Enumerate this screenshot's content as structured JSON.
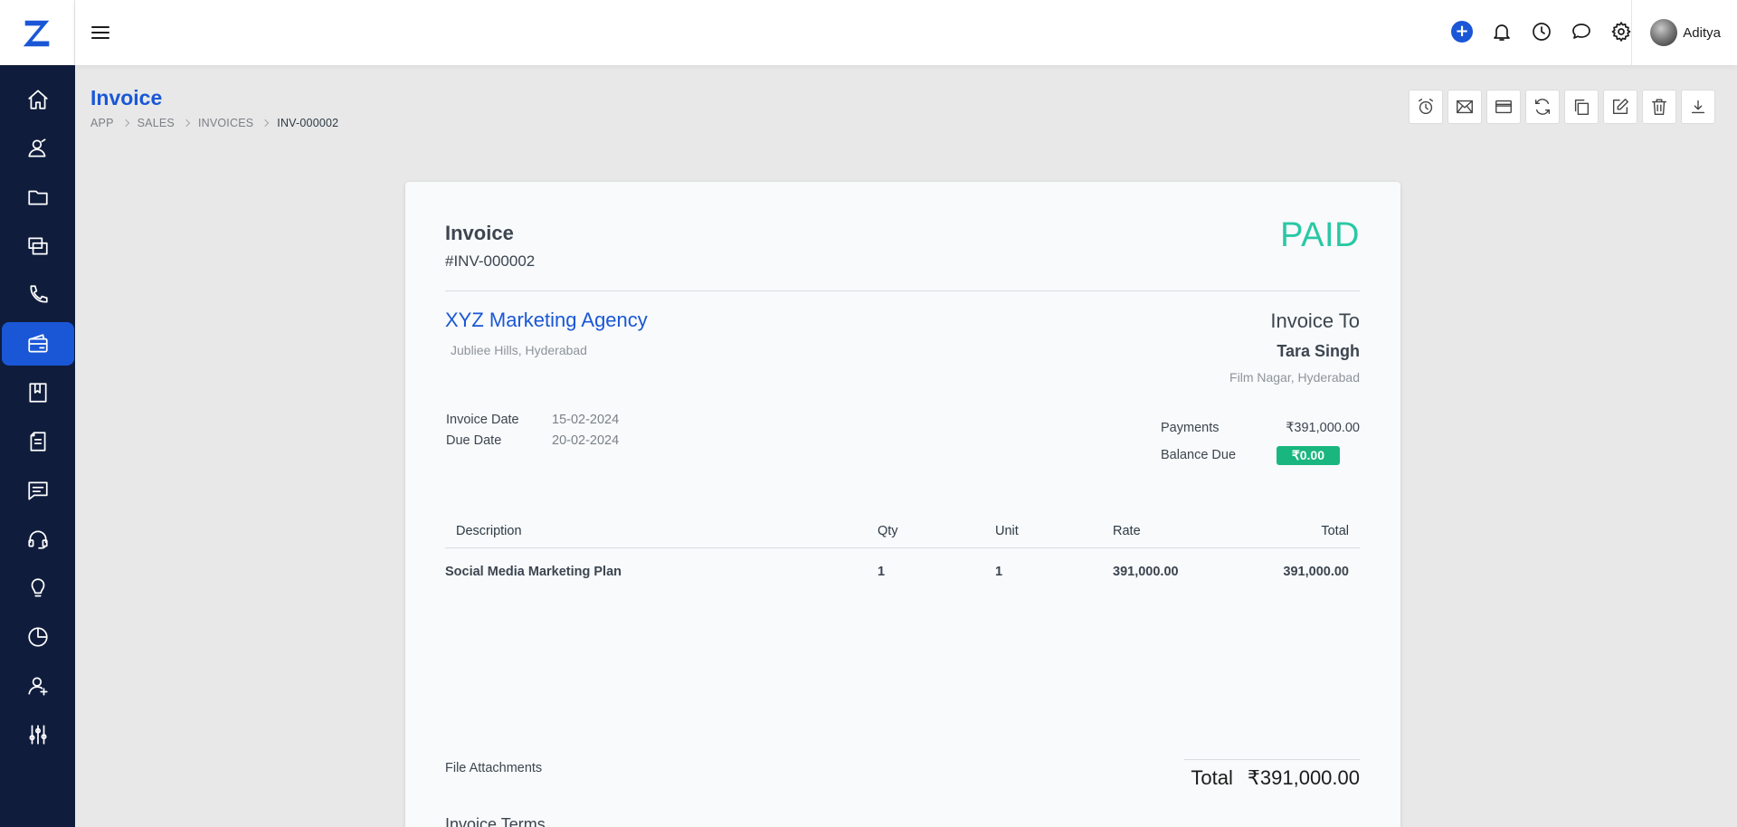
{
  "app": {
    "user_name": "Aditya"
  },
  "sidebar": {
    "items": [
      {
        "icon": "home-icon",
        "active": false
      },
      {
        "icon": "contacts-icon",
        "active": false
      },
      {
        "icon": "folder-icon",
        "active": false
      },
      {
        "icon": "layers-icon",
        "active": false
      },
      {
        "icon": "phone-icon",
        "active": false
      },
      {
        "icon": "wallet-icon",
        "active": true
      },
      {
        "icon": "book-icon",
        "active": false
      },
      {
        "icon": "documents-icon",
        "active": false
      },
      {
        "icon": "chat-icon",
        "active": false
      },
      {
        "icon": "headset-icon",
        "active": false
      },
      {
        "icon": "lightbulb-icon",
        "active": false
      },
      {
        "icon": "pie-chart-icon",
        "active": false
      },
      {
        "icon": "user-add-icon",
        "active": false
      },
      {
        "icon": "sliders-icon",
        "active": false
      }
    ]
  },
  "header": {
    "title": "Invoice",
    "breadcrumb": [
      "APP",
      "SALES",
      "INVOICES",
      "INV-000002"
    ]
  },
  "toolbar": {
    "actions": [
      "reminder-icon",
      "email-icon",
      "card-icon",
      "refresh-icon",
      "copy-icon",
      "edit-icon",
      "delete-icon",
      "download-icon"
    ]
  },
  "invoice": {
    "label": "Invoice",
    "number": "#INV-000002",
    "status": "PAID",
    "company": {
      "name": "XYZ Marketing Agency",
      "address": "Jubliee Hills, Hyderabad"
    },
    "invoice_to": {
      "label": "Invoice To",
      "name": "Tara Singh",
      "address": "Film Nagar, Hyderabad"
    },
    "dates": {
      "invoice_date_label": "Invoice Date",
      "invoice_date": "15-02-2024",
      "due_date_label": "Due Date",
      "due_date": "20-02-2024"
    },
    "payments": {
      "payments_label": "Payments",
      "payments_value": "₹391,000.00",
      "balance_label": "Balance Due",
      "balance_value": "₹0.00"
    },
    "table": {
      "headers": {
        "description": "Description",
        "qty": "Qty",
        "unit": "Unit",
        "rate": "Rate",
        "total": "Total"
      },
      "rows": [
        {
          "description": "Social Media Marketing Plan",
          "qty": "1",
          "unit": "1",
          "rate": "391,000.00",
          "total": "391,000.00"
        }
      ]
    },
    "attachments_label": "File Attachments",
    "total_label": "Total",
    "total_value": "₹391,000.00",
    "terms_label": "Invoice Terms"
  },
  "colors": {
    "sidebar": "#0f1c3c",
    "accent": "#1a57d6",
    "paid": "#2ac8a5",
    "balance_badge": "#19b77f"
  }
}
